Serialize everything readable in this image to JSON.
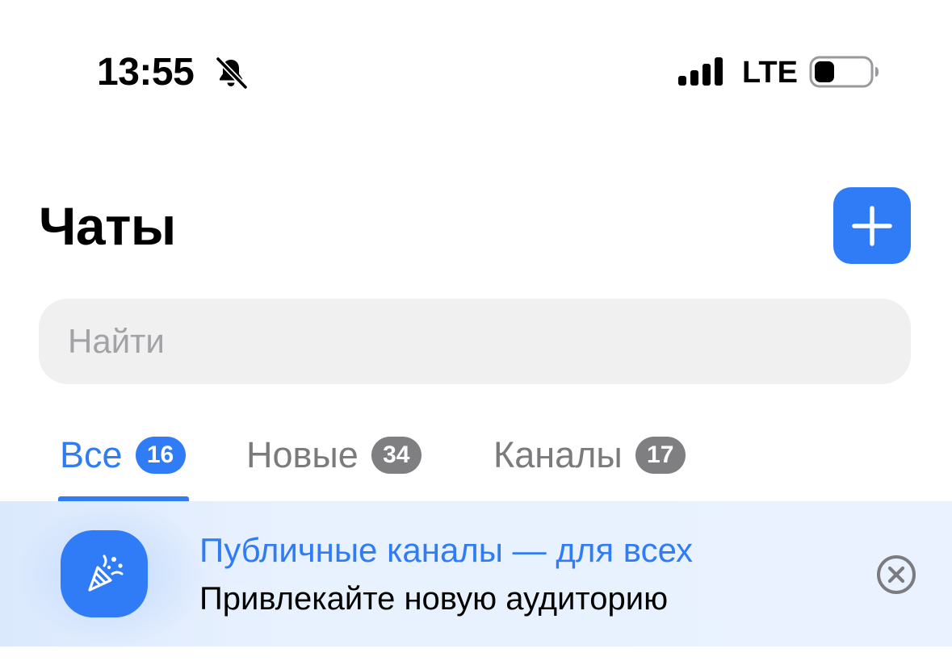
{
  "status_bar": {
    "time": "13:55",
    "network": "LTE",
    "icons": [
      "bell-slash-icon",
      "signal-bars-icon",
      "battery-icon"
    ]
  },
  "header": {
    "title": "Чаты",
    "add_button_icon": "plus-icon"
  },
  "search": {
    "placeholder": "Найти",
    "value": ""
  },
  "tabs": [
    {
      "label": "Все",
      "badge": "16",
      "active": true
    },
    {
      "label": "Новые",
      "badge": "34",
      "active": false
    },
    {
      "label": "Каналы",
      "badge": "17",
      "active": false
    }
  ],
  "promo": {
    "icon": "party-popper-icon",
    "title": "Публичные каналы — для всех",
    "subtitle": "Привлекайте новую аудиторию",
    "close_icon": "close-circle-icon"
  },
  "colors": {
    "accent": "#2f7cf6",
    "badge_inactive": "#7f7f82",
    "tab_inactive_text": "#7b7b7e",
    "search_background": "#f0f0f0",
    "banner_background": "#e8f1fe"
  }
}
